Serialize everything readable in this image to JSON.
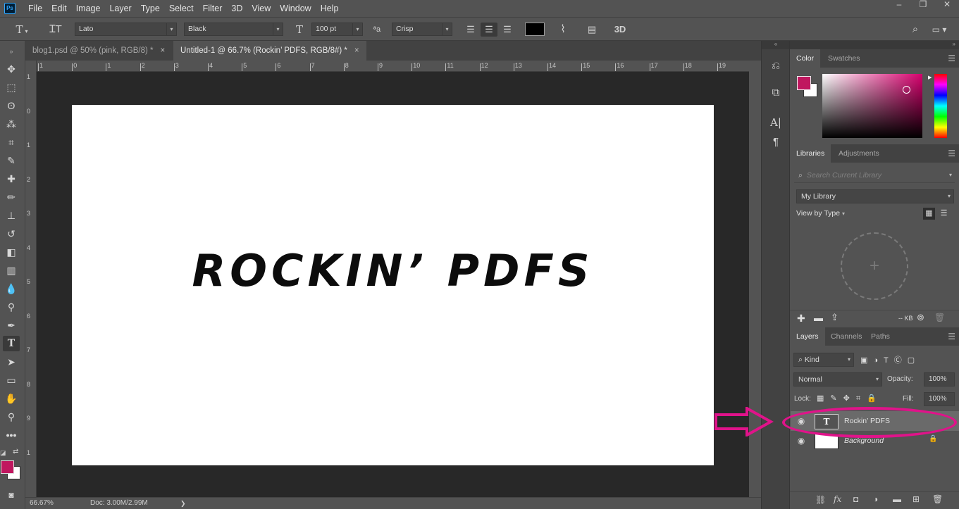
{
  "colors": {
    "accent": "#e0138a",
    "foreground_swatch": "#c0175f",
    "ui_bg": "#535353",
    "ui_dark": "#424242"
  },
  "menubar": {
    "logo": "Ps",
    "items": [
      "File",
      "Edit",
      "Image",
      "Layer",
      "Type",
      "Select",
      "Filter",
      "3D",
      "View",
      "Window",
      "Help"
    ]
  },
  "window_controls": [
    "–",
    "❐",
    "✕"
  ],
  "options": {
    "tool_icon": "T",
    "font_family": "Lato",
    "font_style": "Black",
    "size_icon": "T",
    "font_size": "100 pt",
    "aa_icon": "ªa",
    "antialias": "Crisp",
    "warp": "3D"
  },
  "tabs": [
    {
      "label": "blog1.psd @ 50% (pink, RGB/8) *",
      "close": "×"
    },
    {
      "label": "Untitled-1 @ 66.7% (Rockin’ PDFS, RGB/8#) *",
      "close": "×"
    }
  ],
  "ruler": {
    "top": [
      "1",
      "0",
      "1",
      "2",
      "3",
      "4",
      "5",
      "6",
      "7",
      "8",
      "9",
      "10",
      "11",
      "12",
      "13",
      "14",
      "15",
      "16",
      "17",
      "18",
      "19"
    ],
    "left": [
      "1",
      "0",
      "1",
      "2",
      "3",
      "4",
      "5",
      "6",
      "7",
      "8",
      "9",
      "1"
    ]
  },
  "canvas": {
    "text": "ROCKIN’ PDFS"
  },
  "status": {
    "zoom": "66.67%",
    "doc": "Doc: 3.00M/2.99M",
    "arrow": "❯"
  },
  "panels": {
    "color": {
      "tabs": [
        "Color",
        "Swatches"
      ]
    },
    "libraries": {
      "tabs": [
        "Libraries",
        "Adjustments"
      ],
      "search_placeholder": "Search Current Library",
      "library": "My Library",
      "view_by": "View by Type",
      "size": "-- KB"
    },
    "layers": {
      "tabs": [
        "Layers",
        "Channels",
        "Paths"
      ],
      "kind": "Kind",
      "blend": "Normal",
      "opacity_label": "Opacity:",
      "opacity": "100%",
      "lock_label": "Lock:",
      "fill_label": "Fill:",
      "fill": "100%",
      "items": [
        {
          "name": "Rockin’ PDFS",
          "type": "text",
          "thumb_glyph": "T"
        },
        {
          "name": "Background",
          "type": "image",
          "lock": "🔒"
        }
      ]
    }
  }
}
